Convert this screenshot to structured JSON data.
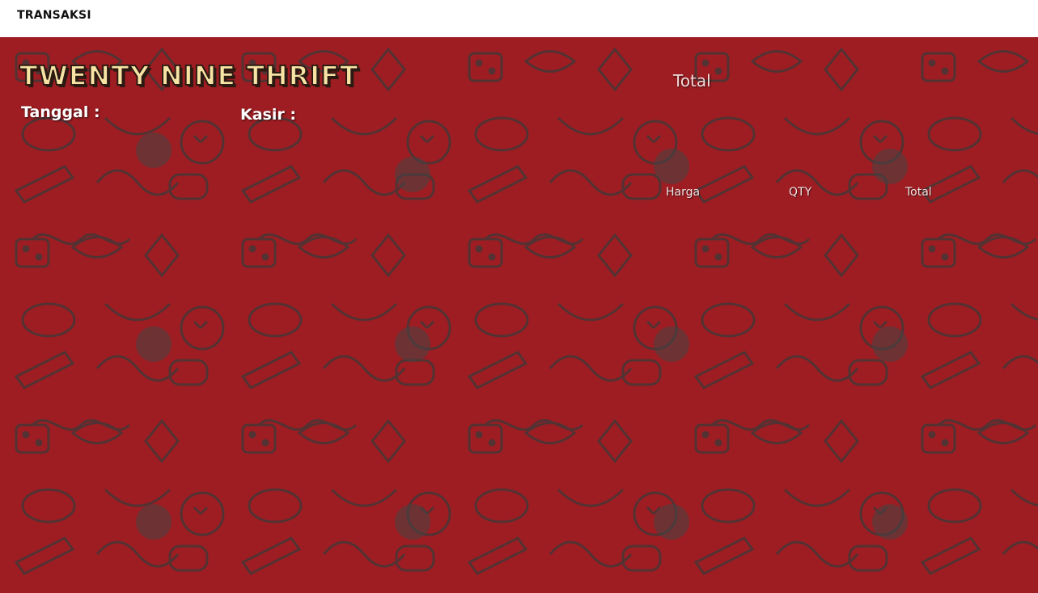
{
  "window": {
    "title": "TRANSAKSI"
  },
  "store": {
    "name": "TWENTY NINE THRIFT"
  },
  "fields": {
    "date_label": "Tanggal :",
    "cashier_label": "Kasir :"
  },
  "summary": {
    "total_label": "Total"
  },
  "table": {
    "headers": [
      "Harga",
      "QTY",
      "Total"
    ]
  },
  "colors": {
    "background": "#9e1d22",
    "doodle": "#4a4a4a",
    "title_fill": "#f7e3a4"
  }
}
